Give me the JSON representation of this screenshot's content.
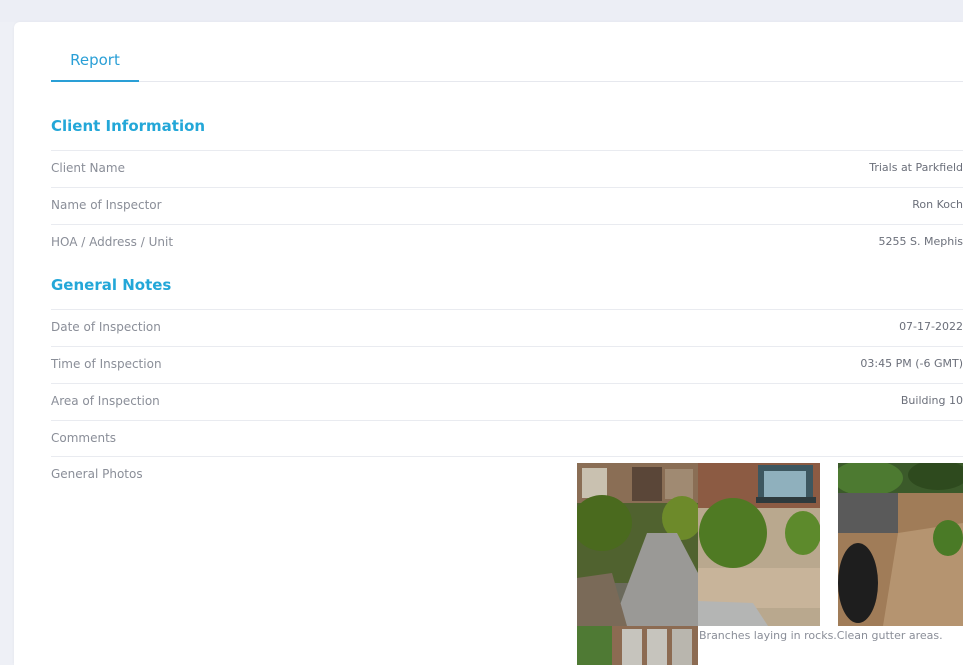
{
  "tabs": [
    {
      "label": "Report"
    }
  ],
  "client_section": {
    "title": "Client Information",
    "rows": [
      {
        "label": "Client Name",
        "value": "Trials at Parkfield"
      },
      {
        "label": "Name of Inspector",
        "value": "Ron Koch"
      },
      {
        "label": "HOA / Address / Unit",
        "value": "5255 S. Mephis"
      }
    ]
  },
  "notes_section": {
    "title": "General Notes",
    "rows": [
      {
        "label": "Date of Inspection",
        "value": "07-17-2022"
      },
      {
        "label": "Time of Inspection",
        "value": "03:45 PM (-6 GMT)"
      },
      {
        "label": "Area of Inspection",
        "value": "Building 10"
      },
      {
        "label": "Comments",
        "value": ""
      },
      {
        "label": "General Photos",
        "value": ""
      }
    ]
  },
  "photo_caption": "Branches laying in rocks.Clean gutter areas.",
  "colors": {
    "accent": "#23a7d8",
    "divider": "#e9ebf0"
  }
}
